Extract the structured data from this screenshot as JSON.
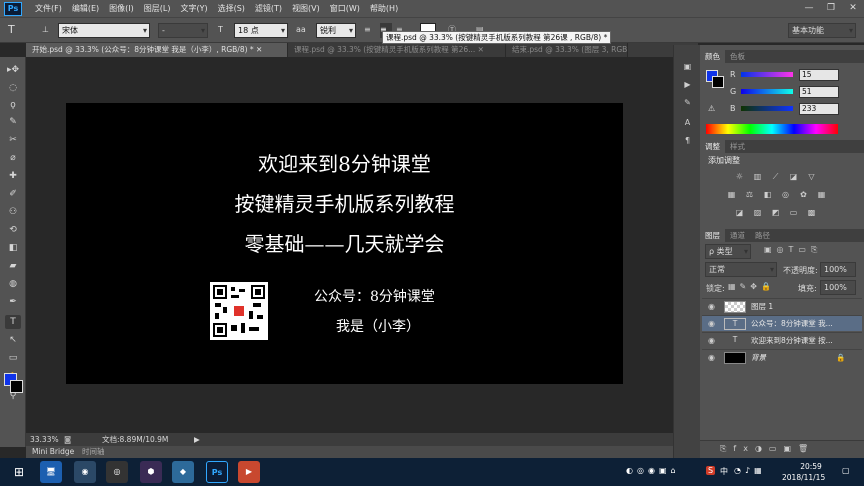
{
  "menubar": {
    "logo": "Ps",
    "items": [
      "文件(F)",
      "编辑(E)",
      "图像(I)",
      "图层(L)",
      "文字(Y)",
      "选择(S)",
      "滤镜(T)",
      "视图(V)",
      "窗口(W)",
      "帮助(H)"
    ],
    "win": [
      "—",
      "❐",
      "✕"
    ]
  },
  "options": {
    "tool_icon": "T",
    "font": "宋体",
    "style": "-",
    "size": "18 点",
    "aa_icon": "aa",
    "aa": "锐利",
    "workspace": "基本功能"
  },
  "tooltip": "课程.psd @ 33.3% (按键精灵手机版系列教程 第26课 , RGB/8) *",
  "tabs": [
    "开始.psd @ 33.3% (公众号：8分钟课堂 我是（小李）, RGB/8) * ✕",
    "课程.psd @ 33.3% (按键精灵手机版系列教程 第26... ✕",
    "结束.psd @ 33.3% (图层 3, RGB/... ✕"
  ],
  "tools": [
    "▸✥",
    "◌",
    "ϙ",
    "✎",
    "✂",
    "⌀",
    "✚",
    "✐",
    "⚇",
    "⟲",
    "◧",
    "▰",
    "◍",
    "✒",
    "T",
    "↖",
    "▭",
    "✋",
    "⚲"
  ],
  "canvas": {
    "line1": "欢迎来到8分钟课堂",
    "line2": "按键精灵手机版系列教程",
    "line3": "零基础——几天就学会",
    "wechat": "公众号：8分钟课堂",
    "me": "我是（小李）"
  },
  "status": {
    "zoom": "33.33%",
    "doc": "文档:8.89M/10.9M",
    "tab1": "Mini Bridge",
    "tab2": "时间轴"
  },
  "color_panel": {
    "tabs": [
      "颜色",
      "色板"
    ],
    "r_label": "R",
    "g_label": "G",
    "b_label": "B",
    "r": "15",
    "g": "51",
    "b": "233",
    "fg_hex": "#0f33e9"
  },
  "adjust_panel": {
    "tabs": [
      "调整",
      "样式"
    ],
    "title": "添加调整"
  },
  "layers_panel": {
    "tabs": [
      "图层",
      "通道",
      "路径"
    ],
    "kind": "ρ 类型",
    "blend": "正常",
    "opacity_label": "不透明度:",
    "opacity": "100%",
    "lock_label": "锁定:",
    "fill_label": "填充:",
    "fill": "100%",
    "layers": [
      {
        "name": "图层 1",
        "type": "pixel"
      },
      {
        "name": "公众号：8分钟课堂 我...",
        "type": "text"
      },
      {
        "name": "欢迎来到8分钟课堂 按...",
        "type": "text"
      },
      {
        "name": "背景",
        "type": "bg"
      }
    ]
  },
  "taskbar": {
    "time": "20:59",
    "date": "2018/11/15",
    "ime": "中",
    "ps": "Ps"
  }
}
